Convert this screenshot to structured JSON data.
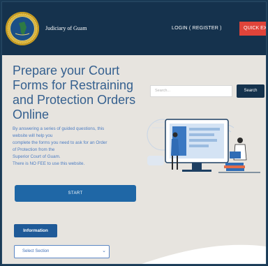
{
  "header": {
    "brand_name": "Judiciary of Guam",
    "login_label": "LOGIN ( REGISTER )",
    "quick_exit_label": "QUICK EXIT",
    "seal_icon": "judiciary-seal-icon"
  },
  "search": {
    "placeholder": "Search...",
    "button_label": "Search"
  },
  "hero": {
    "title": "Prepare your Court Forms for Restraining and Protection Orders Online",
    "description_lines": [
      "By answering a series of guided questions, this",
      "website will help you",
      "complete the forms you need to ask for an Order",
      "of Protection from the",
      "Superior Court of Guam.",
      "There is NO FEE to use this website."
    ],
    "start_label": "START"
  },
  "information": {
    "button_label": "Information",
    "select_value": "Select Section"
  },
  "colors": {
    "header_bg": "#15324d",
    "quick_exit": "#e0443a",
    "accent_blue": "#1f67a6",
    "title_blue": "#35608f",
    "page_bg": "#e7e4df"
  }
}
